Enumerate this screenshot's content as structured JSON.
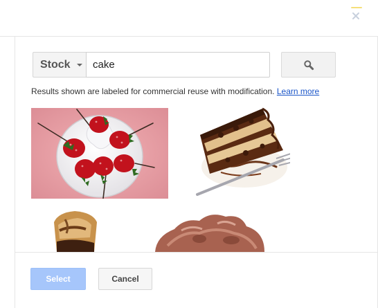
{
  "header": {
    "close_icon": "close-icon"
  },
  "search": {
    "source_label": "Stock",
    "query": "cake",
    "search_icon": "search-icon"
  },
  "notice": {
    "text": "Results shown are labeled for commercial reuse with modification.",
    "link_text": "Learn more"
  },
  "results": [
    {
      "subject": "strawberries-on-plate"
    },
    {
      "subject": "chocolate-cake-slice"
    },
    {
      "subject": "chocolate-bar"
    },
    {
      "subject": "chocolate-candy"
    }
  ],
  "footer": {
    "select_label": "Select",
    "cancel_label": "Cancel"
  },
  "colors": {
    "link": "#1a55c8",
    "select_button": "#a6c6fb",
    "result_1_background": "#e89aa1"
  }
}
